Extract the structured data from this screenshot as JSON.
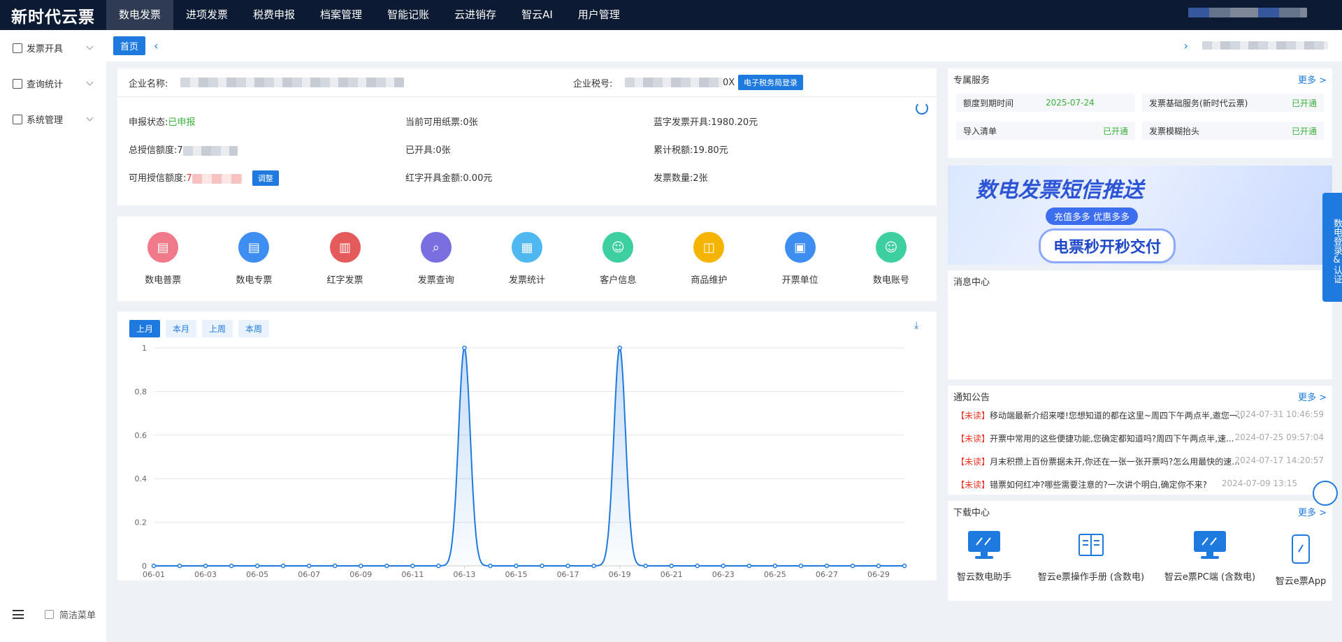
{
  "app": {
    "logo": "新时代云票"
  },
  "topnav": [
    "数电发票",
    "进项发票",
    "税费申报",
    "档案管理",
    "智能记账",
    "云进销存",
    "智云AI",
    "用户管理"
  ],
  "sidebar": {
    "items": [
      "发票开具",
      "查询统计",
      "系统管理"
    ],
    "simple_menu": "简洁菜单"
  },
  "tabs": {
    "home": "首页"
  },
  "company": {
    "name_label": "企业名称:",
    "tax_label": "企业税号:",
    "tax_suffix": "0X",
    "login_btn": "电子税务局登录"
  },
  "stats": {
    "report_status_label": "申报状态:",
    "report_status": "已申报",
    "avail_paper_label": "当前可用纸票:",
    "avail_paper": "0张",
    "blue_label": "蓝字发票开具:",
    "blue": "1980.20元",
    "credit_label": "总授信额度:",
    "credit_prefix": "7",
    "issued_label": "已开具:",
    "issued": "0张",
    "tax_total_label": "累计税额:",
    "tax_total": "19.80元",
    "avail_credit_label": "可用授信额度:",
    "avail_credit_prefix": "7",
    "adjust_btn": "调整",
    "red_label": "红字开具金额:",
    "red": "0.00元",
    "count_label": "发票数量:",
    "count": "2张"
  },
  "functions": [
    {
      "label": "数电普票",
      "icon": "invoice-icon",
      "color": "#f17a8a"
    },
    {
      "label": "数电专票",
      "icon": "special-invoice-icon",
      "color": "#3d8ef0"
    },
    {
      "label": "红字发票",
      "icon": "red-invoice-icon",
      "color": "#e55a5a"
    },
    {
      "label": "发票查询",
      "icon": "search-doc-icon",
      "color": "#7a6fe0"
    },
    {
      "label": "发票统计",
      "icon": "stats-doc-icon",
      "color": "#4fb8f0"
    },
    {
      "label": "客户信息",
      "icon": "customer-icon",
      "color": "#3dcfa0"
    },
    {
      "label": "商品维护",
      "icon": "goods-icon",
      "color": "#f5b400"
    },
    {
      "label": "开票单位",
      "icon": "unit-icon",
      "color": "#3d8ef0"
    },
    {
      "label": "数电账号",
      "icon": "account-icon",
      "color": "#3dcfa0"
    }
  ],
  "chart_ranges": [
    "上月",
    "本月",
    "上周",
    "本周"
  ],
  "chart_data": {
    "type": "area",
    "x": [
      "06-01",
      "06-02",
      "06-03",
      "06-04",
      "06-05",
      "06-06",
      "06-07",
      "06-08",
      "06-09",
      "06-10",
      "06-11",
      "06-12",
      "06-13",
      "06-14",
      "06-15",
      "06-16",
      "06-17",
      "06-18",
      "06-19",
      "06-20",
      "06-21",
      "06-22",
      "06-23",
      "06-24",
      "06-25",
      "06-26",
      "06-27",
      "06-28",
      "06-29",
      "06-30"
    ],
    "tick_labels": [
      "06-01",
      "06-03",
      "06-05",
      "06-07",
      "06-09",
      "06-11",
      "06-13",
      "06-15",
      "06-17",
      "06-19",
      "06-21",
      "06-23",
      "06-25",
      "06-27",
      "06-29"
    ],
    "values": [
      0,
      0,
      0,
      0,
      0,
      0,
      0,
      0,
      0,
      0,
      0,
      0,
      1,
      0,
      0,
      0,
      0,
      0,
      1,
      0,
      0,
      0,
      0,
      0,
      0,
      0,
      0,
      0,
      0,
      0
    ],
    "y_ticks": [
      "0",
      "0.2",
      "0.4",
      "0.6",
      "0.8",
      "1"
    ],
    "ylim": [
      0,
      1
    ],
    "grid": true,
    "color": "#1f7ae0"
  },
  "service": {
    "title": "专属服务",
    "more": "更多 >",
    "items": [
      {
        "label": "额度到期时间",
        "value": "2025-07-24"
      },
      {
        "label": "发票基础服务(新时代云票)",
        "value": "已开通"
      },
      {
        "label": "导入清单",
        "value": "已开通"
      },
      {
        "label": "发票模糊抬头",
        "value": "已开通"
      }
    ]
  },
  "banner": {
    "title": "数电发票短信推送",
    "sub": "充值多多 优惠多多",
    "main": "电票秒开秒交付"
  },
  "message": {
    "title": "消息中心"
  },
  "notices": {
    "title": "通知公告",
    "more": "更多 >",
    "tag": "【未读】",
    "items": [
      {
        "text": "移动端最新介绍来喽!您想知道的都在这里~周四下午两点半,邀您一...",
        "date": "2024-07-31 10:46:59"
      },
      {
        "text": "开票中常用的这些便捷功能,您确定都知道吗?周四下午两点半,速...",
        "date": "2024-07-25 09:57:04"
      },
      {
        "text": "月末积攒上百份票据未开,你还在一张一张开票吗?怎么用最快的速...",
        "date": "2024-07-17 14:20:57"
      },
      {
        "text": "错票如何红冲?哪些需要注意的?一次讲个明白,确定你不来?",
        "date": "2024-07-09 13:15"
      }
    ]
  },
  "download": {
    "title": "下载中心",
    "more": "更多 >",
    "items": [
      "智云数电助手",
      "智云e票操作手册 (含数电)",
      "智云e票PC端 (含数电)",
      "智云e票App"
    ]
  },
  "float": {
    "text": "数电登录&认证"
  }
}
